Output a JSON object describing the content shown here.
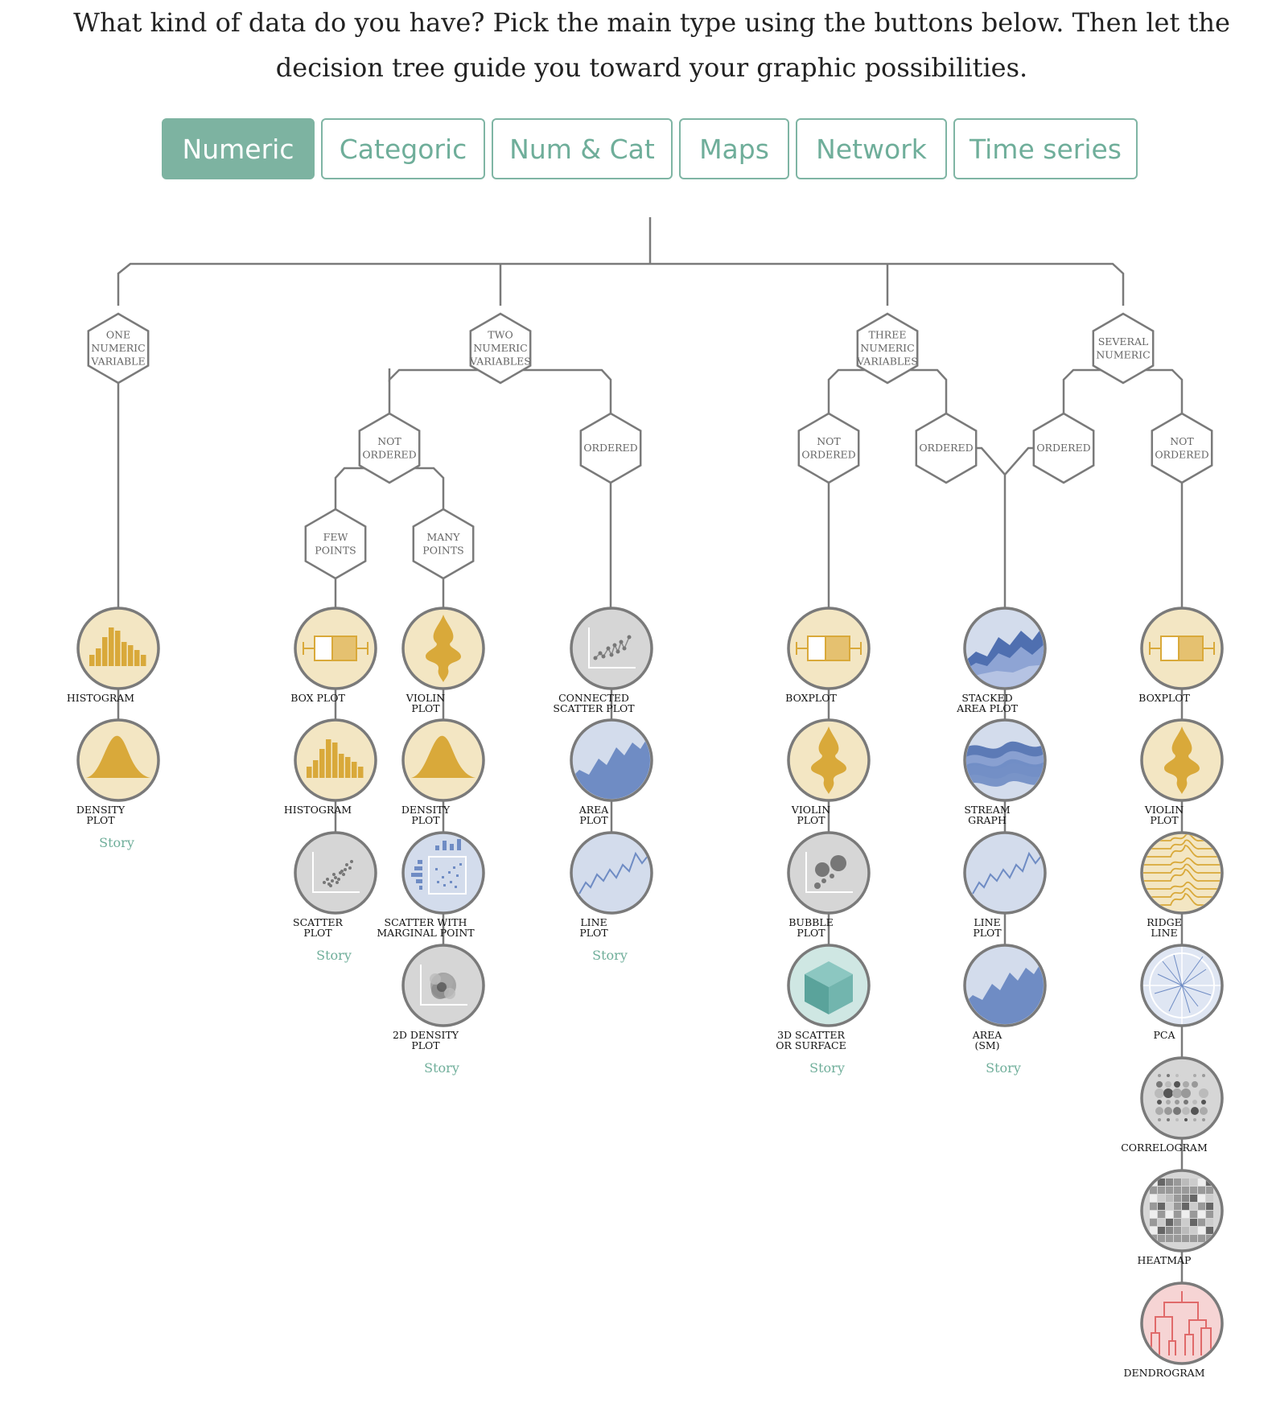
{
  "intro": {
    "line1": "What kind of data do you have? Pick the main type using the buttons below. Then let the",
    "line2": "decision tree guide you toward your graphic possibilities."
  },
  "tabs": [
    {
      "label": "Numeric",
      "active": true
    },
    {
      "label": "Categoric",
      "active": false
    },
    {
      "label": "Num & Cat",
      "active": false
    },
    {
      "label": "Maps",
      "active": false
    },
    {
      "label": "Network",
      "active": false
    },
    {
      "label": "Time series",
      "active": false
    }
  ],
  "colors": {
    "accent": "#7db3a1",
    "line": "#7a7a7a",
    "yellow_fill": "#f3e6c3",
    "yellow_mark": "#d9a93a",
    "blue_fill": "#d3dcec",
    "blue_mark": "#6f8cc4",
    "grey_fill": "#d6d6d6",
    "teal_fill": "#cfe7e3",
    "red_mark": "#e06a6a"
  },
  "hexes": [
    {
      "id": "h1",
      "lines": [
        "ONE",
        "NUMERIC",
        "VARIABLE"
      ]
    },
    {
      "id": "h2",
      "lines": [
        "TWO",
        "NUMERIC",
        "VARIABLES"
      ]
    },
    {
      "id": "h3",
      "lines": [
        "THREE",
        "NUMERIC",
        "VARIABLES"
      ]
    },
    {
      "id": "h4",
      "lines": [
        "SEVERAL",
        "NUMERIC"
      ]
    },
    {
      "id": "h5",
      "lines": [
        "NOT",
        "ORDERED"
      ]
    },
    {
      "id": "h6",
      "lines": [
        "ORDERED"
      ]
    },
    {
      "id": "h7",
      "lines": [
        "NOT",
        "ORDERED"
      ]
    },
    {
      "id": "h8",
      "lines": [
        "ORDERED"
      ]
    },
    {
      "id": "h9",
      "lines": [
        "ORDERED"
      ]
    },
    {
      "id": "h10",
      "lines": [
        "NOT",
        "ORDERED"
      ]
    },
    {
      "id": "h11",
      "lines": [
        "FEW",
        "POINTS"
      ]
    },
    {
      "id": "h12",
      "lines": [
        "MANY",
        "POINTS"
      ]
    }
  ],
  "columns": [
    {
      "charts": [
        {
          "icon": "histogram-icon",
          "label": [
            "HISTOGRAM"
          ]
        },
        {
          "icon": "density-icon",
          "label": [
            "DENSITY",
            "PLOT"
          ]
        }
      ],
      "story": "Story"
    },
    {
      "charts": [
        {
          "icon": "boxplot-icon",
          "label": [
            "BOX PLOT"
          ]
        },
        {
          "icon": "histogram-icon",
          "label": [
            "HISTOGRAM"
          ]
        },
        {
          "icon": "scatter-icon",
          "label": [
            "SCATTER",
            "PLOT"
          ]
        }
      ],
      "story": "Story"
    },
    {
      "charts": [
        {
          "icon": "violin-icon",
          "label": [
            "VIOLIN",
            "PLOT"
          ]
        },
        {
          "icon": "density-icon",
          "label": [
            "DENSITY",
            "PLOT"
          ]
        },
        {
          "icon": "marginal-scatter-icon",
          "label": [
            "SCATTER WITH",
            "MARGINAL POINT"
          ]
        },
        {
          "icon": "density2d-icon",
          "label": [
            "2D DENSITY",
            "PLOT"
          ]
        }
      ],
      "story": "Story"
    },
    {
      "charts": [
        {
          "icon": "connected-scatter-icon",
          "label": [
            "CONNECTED",
            "SCATTER PLOT"
          ]
        },
        {
          "icon": "area-icon",
          "label": [
            "AREA",
            "PLOT"
          ]
        },
        {
          "icon": "line-icon",
          "label": [
            "LINE",
            "PLOT"
          ]
        }
      ],
      "story": "Story"
    },
    {
      "charts": [
        {
          "icon": "boxplot-icon",
          "label": [
            "BOXPLOT"
          ]
        },
        {
          "icon": "violin-icon",
          "label": [
            "VIOLIN",
            "PLOT"
          ]
        },
        {
          "icon": "bubble-icon",
          "label": [
            "BUBBLE",
            "PLOT"
          ]
        },
        {
          "icon": "cube-icon",
          "label": [
            "3D SCATTER",
            "OR SURFACE"
          ]
        }
      ],
      "story": "Story"
    },
    {
      "charts": [
        {
          "icon": "stacked-area-icon",
          "label": [
            "STACKED",
            "AREA PLOT"
          ]
        },
        {
          "icon": "stream-icon",
          "label": [
            "STREAM",
            "GRAPH"
          ]
        },
        {
          "icon": "line-icon",
          "label": [
            "LINE",
            "PLOT"
          ]
        },
        {
          "icon": "area-icon",
          "label": [
            "AREA",
            "(SM)"
          ]
        }
      ],
      "story": "Story"
    },
    {
      "charts": [
        {
          "icon": "boxplot-icon",
          "label": [
            "BOXPLOT"
          ]
        },
        {
          "icon": "violin-icon",
          "label": [
            "VIOLIN",
            "PLOT"
          ]
        },
        {
          "icon": "ridgeline-icon",
          "label": [
            "RIDGE",
            "LINE"
          ]
        },
        {
          "icon": "pca-icon",
          "label": [
            "PCA"
          ]
        },
        {
          "icon": "correlogram-icon",
          "label": [
            "CORRELOGRAM"
          ]
        },
        {
          "icon": "heatmap-icon",
          "label": [
            "HEATMAP"
          ]
        },
        {
          "icon": "dendrogram-icon",
          "label": [
            "DENDROGRAM"
          ]
        }
      ],
      "story": ""
    }
  ]
}
